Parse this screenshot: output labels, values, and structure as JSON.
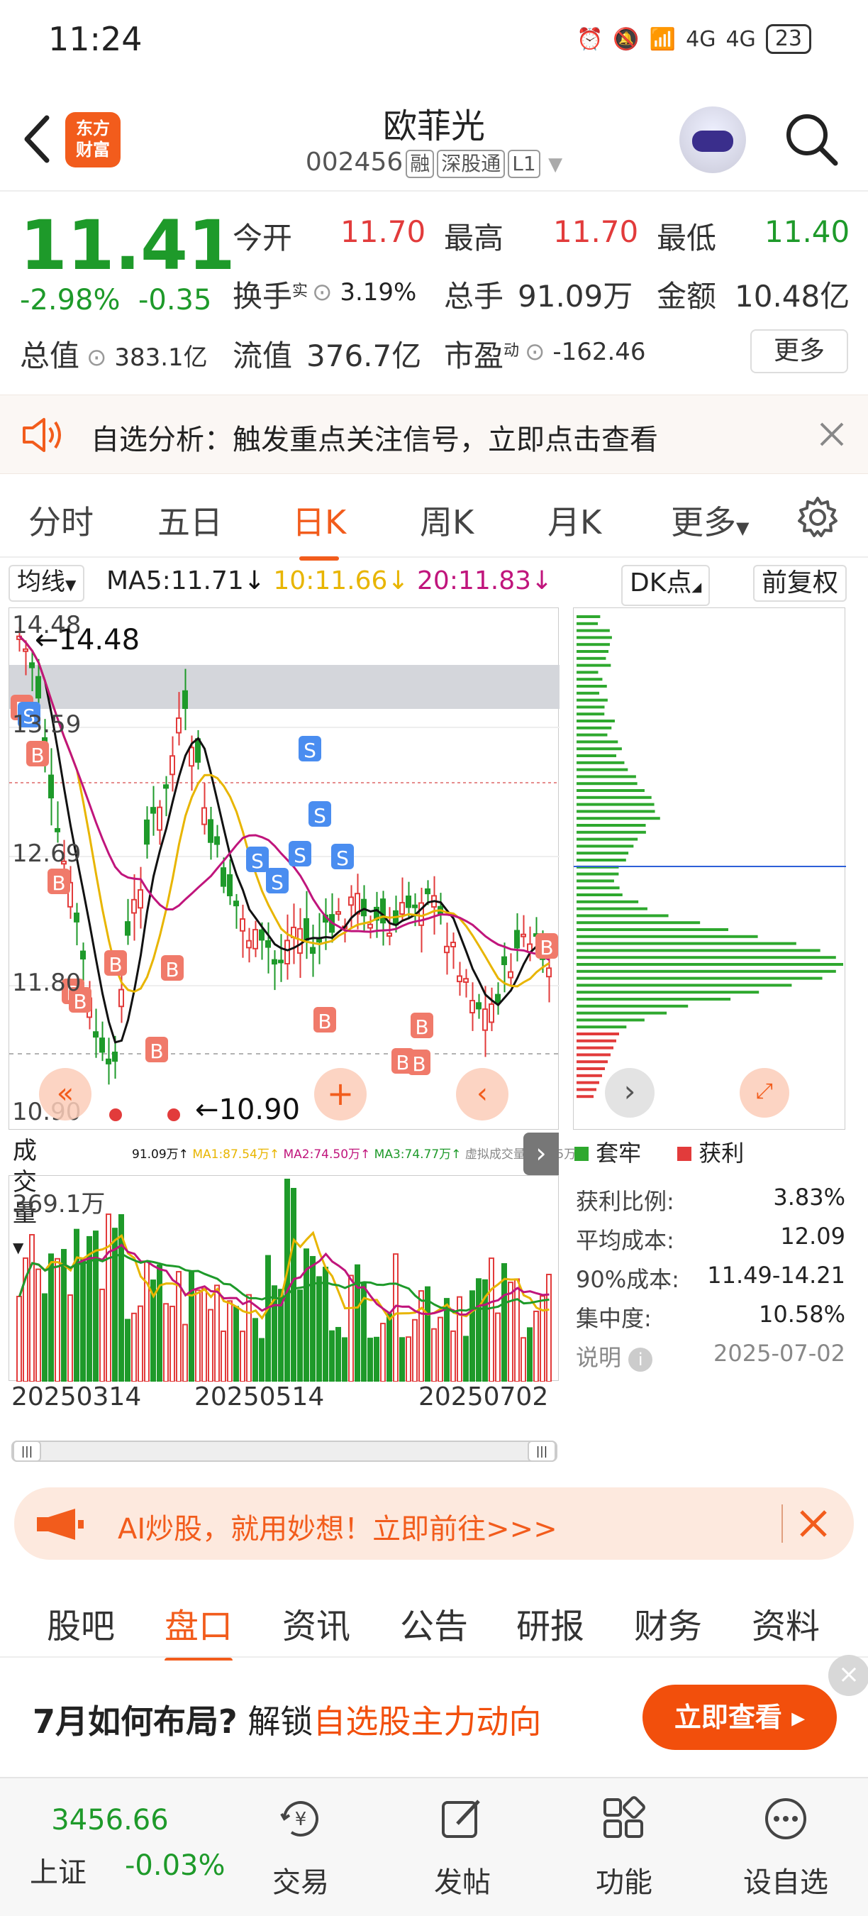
{
  "status": {
    "time": "11:24",
    "signal_1": "4G",
    "signal_2": "4G",
    "battery": "23"
  },
  "header": {
    "title": "欧菲光",
    "code": "002456",
    "tags": [
      "融",
      "深股通",
      "L1"
    ],
    "logo_line1": "东方",
    "logo_line2": "财富"
  },
  "quote": {
    "price": "11.41",
    "change_pct": "-2.98%",
    "change_abs": "-0.35",
    "open_label": "今开",
    "open": "11.70",
    "high_label": "最高",
    "high": "11.70",
    "low_label": "最低",
    "low": "11.40",
    "turnover_label": "换手",
    "turnover_sup": "实",
    "turnover": "3.19%",
    "vol_label": "总手",
    "vol": "91.09万",
    "amount_label": "金额",
    "amount": "10.48亿",
    "mktcap_label": "总值",
    "mktcap": "383.1亿",
    "float_label": "流值",
    "float": "376.7亿",
    "pe_label": "市盈",
    "pe_sup": "动",
    "pe": "-162.46",
    "more": "更多"
  },
  "notice": {
    "text": "自选分析：触发重点关注信号，立即点击查看"
  },
  "tabs": [
    "分时",
    "五日",
    "日K",
    "周K",
    "月K",
    "更多"
  ],
  "active_tab": 2,
  "ma_bar": {
    "mode": "均线",
    "ma5": "MA5:11.71",
    "ma10": "10:11.66",
    "ma20": "20:11.83",
    "dk": "DK点",
    "adjust": "前复权"
  },
  "chart_data": {
    "type": "candlestick",
    "y_labels": [
      "14.48",
      "13.59",
      "12.69",
      "11.80",
      "10.90"
    ],
    "max_label": "←14.48",
    "min_label": "←10.90",
    "x_labels": [
      "20250314",
      "20250514",
      "20250702"
    ],
    "ylim": [
      10.9,
      14.48
    ]
  },
  "volume": {
    "label": "成交量",
    "legend": [
      "91.09万↑",
      "MA1:87.54万↑",
      "MA2:74.50万↑",
      "MA3:74.77万↑",
      "虚拟成交量:112.5万"
    ],
    "max": "369.1万"
  },
  "chips": {
    "legend_trapped": "套牢",
    "legend_profit": "获利",
    "rows": [
      {
        "label": "获利比例:",
        "value": "3.83%"
      },
      {
        "label": "平均成本:",
        "value": "12.09"
      },
      {
        "label": "90%成本:",
        "value": "11.49-14.21"
      },
      {
        "label": "集中度:",
        "value": "10.58%"
      }
    ],
    "note": "说明",
    "date": "2025-07-02"
  },
  "ai_bar": {
    "text": "AI炒股，就用妙想！立即前往>>>"
  },
  "bottom_tabs": [
    "股吧",
    "盘口",
    "资讯",
    "公告",
    "研报",
    "财务",
    "资料"
  ],
  "active_bottom_tab": 1,
  "promo": {
    "part1": "7月如何布局?",
    "part2": "解锁",
    "part3": "自选股主力动向",
    "button": "立即查看 ▸"
  },
  "navbar": {
    "index_value": "3456.66",
    "index_name": "上证",
    "index_change": "-0.03%",
    "items": [
      "交易",
      "发帖",
      "功能",
      "设自选"
    ]
  },
  "colors": {
    "up": "#e23b3b",
    "down": "#1e9a2a",
    "accent": "#f25c1c",
    "ma5": "#111111",
    "ma10": "#e8b500",
    "ma20": "#c0157c"
  }
}
